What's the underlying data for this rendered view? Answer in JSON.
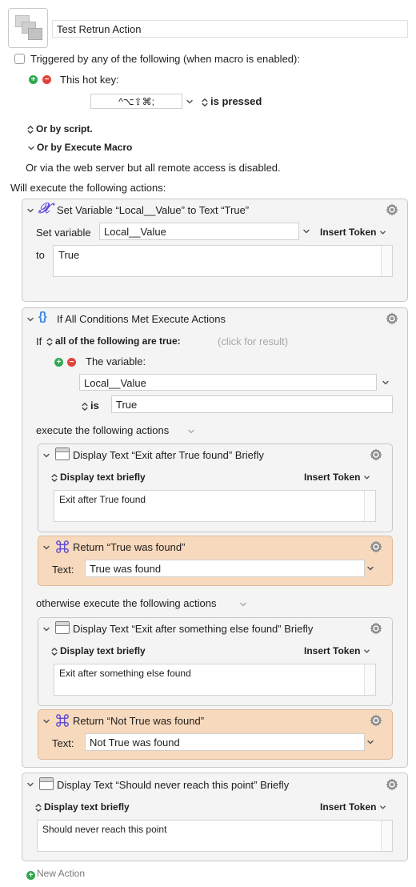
{
  "macro": {
    "name": "Test Retrun Action",
    "trigger_header": "Triggered by any of the following (when macro is enabled):",
    "hotkey_label": "This hot key:",
    "hotkey_value": "^⌥⇧⌘;",
    "hotkey_state": "is pressed",
    "or_by_script": "Or by script.",
    "or_by_execute_macro": "Or by Execute Macro",
    "web_server_note": "Or via the web server but all remote access is disabled.",
    "will_execute": "Will execute the following actions:"
  },
  "actions": {
    "set_variable": {
      "title": "Set Variable “Local__Value” to Text “True”",
      "set_variable_label": "Set variable",
      "variable_value": "Local__Value",
      "insert_token": "Insert Token",
      "to_label": "to",
      "to_value": "True"
    },
    "if_all": {
      "title": "If All Conditions Met Execute Actions",
      "if_label": "If",
      "condition_mode": "all of the following are true:",
      "click_for_result": "(click for result)",
      "condition_type": "The variable:",
      "condition_variable": "Local__Value",
      "operator": "is",
      "condition_value": "True",
      "then_label": "execute the following actions",
      "else_label": "otherwise execute the following actions",
      "then_display": {
        "title": "Display Text “Exit after True found” Briefly",
        "mode": "Display text briefly",
        "insert_token": "Insert Token",
        "text": "Exit after True found"
      },
      "then_return": {
        "title": "Return “True was found”",
        "text_label": "Text:",
        "text_value": "True was found"
      },
      "else_display": {
        "title": "Display Text “Exit after something else found” Briefly",
        "mode": "Display text briefly",
        "insert_token": "Insert Token",
        "text": "Exit after something else found"
      },
      "else_return": {
        "title": "Return “Not True was found”",
        "text_label": "Text:",
        "text_value": "Not True was found"
      }
    },
    "final_display": {
      "title": "Display Text “Should never reach this point” Briefly",
      "mode": "Display text briefly",
      "insert_token": "Insert Token",
      "text": "Should never reach this point"
    }
  },
  "new_action_label": "New Action"
}
